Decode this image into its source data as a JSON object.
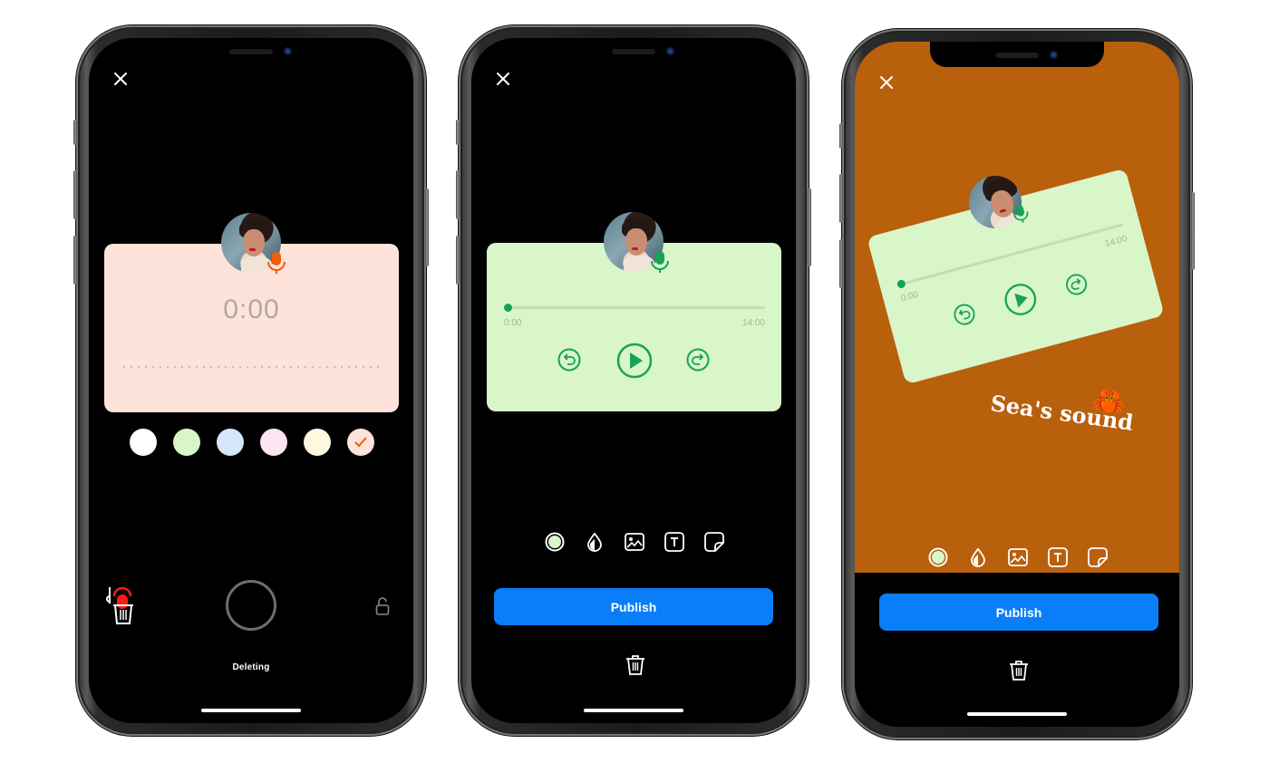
{
  "screens": [
    {
      "id": "recording",
      "close_label": "close",
      "card_color": "#fde3da",
      "timer": "0:00",
      "mic_color": "#f25c05",
      "swatches": [
        {
          "name": "white",
          "color": "#ffffff",
          "selected": false
        },
        {
          "name": "green",
          "color": "#d8f6c8",
          "selected": false
        },
        {
          "name": "blue",
          "color": "#d4e6f7",
          "selected": false
        },
        {
          "name": "pink",
          "color": "#fde4f2",
          "selected": false
        },
        {
          "name": "cream",
          "color": "#fff8e1",
          "selected": false
        },
        {
          "name": "peach",
          "color": "#fde3da",
          "selected": true
        }
      ],
      "status_label": "Deleting",
      "icons": {
        "delete": "trash-mic-icon",
        "record": "record-button",
        "lock": "unlock-icon"
      }
    },
    {
      "id": "preview",
      "card_color": "#d8f6c8",
      "accent": "#16a258",
      "player": {
        "current_time": "0:00",
        "duration": "14:00",
        "progress": 0.0
      },
      "toolbar": [
        "color-icon",
        "drop-icon",
        "image-icon",
        "text-icon",
        "sticker-icon"
      ],
      "publish_label": "Publish",
      "publish_color": "#0a7ef8"
    },
    {
      "id": "story",
      "background_color": "#b9600d",
      "card_color": "#d8f6c8",
      "accent": "#16a258",
      "player": {
        "current_time": "0:00",
        "duration": "14:00",
        "progress": 0.0
      },
      "caption": "Sea's sound",
      "sticker": "🦀",
      "toolbar": [
        "color-icon",
        "drop-icon",
        "image-icon",
        "text-icon",
        "sticker-icon"
      ],
      "publish_label": "Publish",
      "publish_color": "#0a7ef8"
    }
  ]
}
